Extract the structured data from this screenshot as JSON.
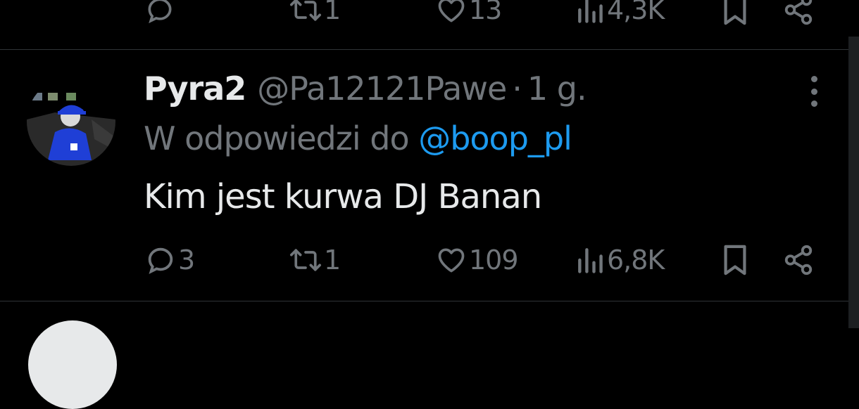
{
  "prev_tweet": {
    "actions": {
      "reply_count": "",
      "retweet_count": "1",
      "like_count": "13",
      "view_count": "4,3K"
    }
  },
  "tweet": {
    "display_name": "Pyra2",
    "handle": "@Pa12121Pawe",
    "separator": "·",
    "time": "1 g.",
    "reply_to_prefix": "W odpowiedzi do",
    "reply_to_handle": "@boop_pl",
    "text": "Kim jest kurwa DJ Banan",
    "actions": {
      "reply_count": "3",
      "retweet_count": "1",
      "like_count": "109",
      "view_count": "6,8K"
    }
  },
  "icons": {
    "reply": "reply-icon",
    "retweet": "retweet-icon",
    "like": "heart-icon",
    "views": "views-icon",
    "bookmark": "bookmark-icon",
    "share": "share-icon",
    "more": "more-icon"
  },
  "colors": {
    "background": "#000000",
    "text": "#e7e9ea",
    "muted": "#71767b",
    "link": "#1d9bf0",
    "divider": "#2f3336",
    "avatar_blue": "#1f3fd6"
  }
}
